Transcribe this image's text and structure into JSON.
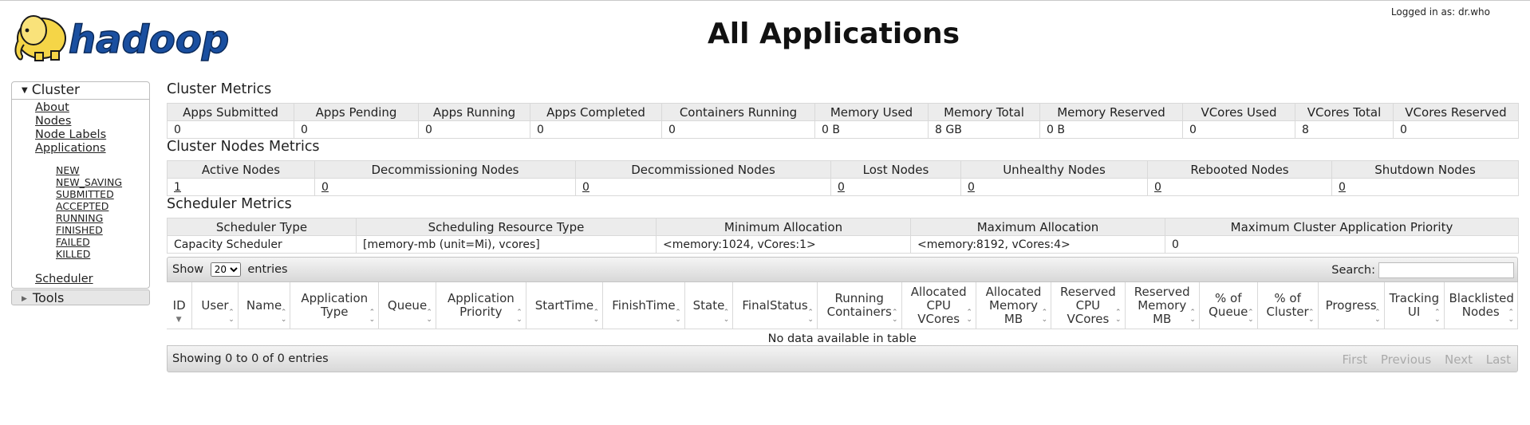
{
  "header": {
    "logo_text": "hadoop",
    "title": "All Applications",
    "logged_in": "Logged in as: dr.who"
  },
  "nav": {
    "cluster_label": "Cluster",
    "links": [
      "About",
      "Nodes",
      "Node Labels",
      "Applications"
    ],
    "app_states": [
      "NEW",
      "NEW_SAVING",
      "SUBMITTED",
      "ACCEPTED",
      "RUNNING",
      "FINISHED",
      "FAILED",
      "KILLED"
    ],
    "scheduler": "Scheduler",
    "tools_label": "Tools"
  },
  "cluster_metrics": {
    "title": "Cluster Metrics",
    "headers": [
      "Apps Submitted",
      "Apps Pending",
      "Apps Running",
      "Apps Completed",
      "Containers Running",
      "Memory Used",
      "Memory Total",
      "Memory Reserved",
      "VCores Used",
      "VCores Total",
      "VCores Reserved"
    ],
    "values": [
      "0",
      "0",
      "0",
      "0",
      "0",
      "0 B",
      "8 GB",
      "0 B",
      "0",
      "8",
      "0"
    ]
  },
  "node_metrics": {
    "title": "Cluster Nodes Metrics",
    "headers": [
      "Active Nodes",
      "Decommissioning Nodes",
      "Decommissioned Nodes",
      "Lost Nodes",
      "Unhealthy Nodes",
      "Rebooted Nodes",
      "Shutdown Nodes"
    ],
    "values": [
      "1",
      "0",
      "0",
      "0",
      "0",
      "0",
      "0"
    ]
  },
  "scheduler_metrics": {
    "title": "Scheduler Metrics",
    "headers": [
      "Scheduler Type",
      "Scheduling Resource Type",
      "Minimum Allocation",
      "Maximum Allocation",
      "Maximum Cluster Application Priority"
    ],
    "values": [
      "Capacity Scheduler",
      "[memory-mb (unit=Mi), vcores]",
      "<memory:1024, vCores:1>",
      "<memory:8192, vCores:4>",
      "0"
    ]
  },
  "apps_table": {
    "show_label": "Show",
    "entries_value": "20",
    "entries_label": "entries",
    "search_label": "Search:",
    "search_value": "",
    "columns": [
      "ID",
      "User",
      "Name",
      "Application Type",
      "Queue",
      "Application Priority",
      "StartTime",
      "FinishTime",
      "State",
      "FinalStatus",
      "Running Containers",
      "Allocated CPU VCores",
      "Allocated Memory MB",
      "Reserved CPU VCores",
      "Reserved Memory MB",
      "% of Queue",
      "% of Cluster",
      "Progress",
      "Tracking UI",
      "Blacklisted Nodes"
    ],
    "empty_message": "No data available in table",
    "info": "Showing 0 to 0 of 0 entries",
    "pager": [
      "First",
      "Previous",
      "Next",
      "Last"
    ]
  },
  "colors": {
    "elephant": "#f5d547",
    "logo_text": "#1a4fa0",
    "header_bg": "#ececec"
  }
}
